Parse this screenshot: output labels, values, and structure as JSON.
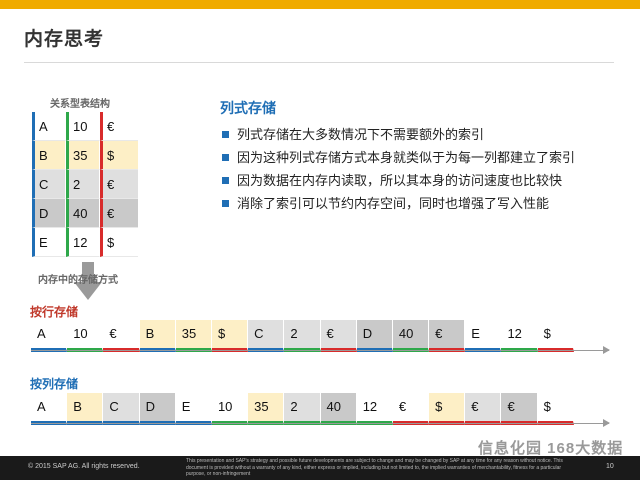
{
  "title": "内存思考",
  "relational": {
    "label": "关系型表结构",
    "rows": [
      {
        "a": "A",
        "b": "10",
        "c": "€",
        "bg": "w"
      },
      {
        "a": "B",
        "b": "35",
        "c": "$",
        "bg": "y"
      },
      {
        "a": "C",
        "b": "2",
        "c": "€",
        "bg": "g"
      },
      {
        "a": "D",
        "b": "40",
        "c": "€",
        "bg": "d"
      },
      {
        "a": "E",
        "b": "12",
        "c": "$",
        "bg": "w"
      }
    ]
  },
  "memory_label": "内存中的存储方式",
  "columnar": {
    "heading": "列式存储",
    "bullets": [
      "列式存储在大多数情况下不需要额外的索引",
      "因为这种列式存储方式本身就类似于为每一列都建立了索引",
      "因为数据在内存内读取，所以其本身的访问速度也比较快",
      "消除了索引可以节约内存空间，同时也增强了写入性能"
    ]
  },
  "row_store": {
    "label": "按行存储",
    "cells": [
      {
        "v": "A",
        "bg": "w",
        "u": "b"
      },
      {
        "v": "10",
        "bg": "w",
        "u": "g"
      },
      {
        "v": "€",
        "bg": "w",
        "u": "r"
      },
      {
        "v": "B",
        "bg": "y",
        "u": "b"
      },
      {
        "v": "35",
        "bg": "y",
        "u": "g"
      },
      {
        "v": "$",
        "bg": "y",
        "u": "r"
      },
      {
        "v": "C",
        "bg": "g",
        "u": "b"
      },
      {
        "v": "2",
        "bg": "g",
        "u": "g"
      },
      {
        "v": "€",
        "bg": "g",
        "u": "r"
      },
      {
        "v": "D",
        "bg": "d",
        "u": "b"
      },
      {
        "v": "40",
        "bg": "d",
        "u": "g"
      },
      {
        "v": "€",
        "bg": "d",
        "u": "r"
      },
      {
        "v": "E",
        "bg": "w",
        "u": "b"
      },
      {
        "v": "12",
        "bg": "w",
        "u": "g"
      },
      {
        "v": "$",
        "bg": "w",
        "u": "r"
      }
    ]
  },
  "col_store": {
    "label": "按列存储",
    "cells": [
      {
        "v": "A",
        "bg": "w",
        "u": "b"
      },
      {
        "v": "B",
        "bg": "y",
        "u": "b"
      },
      {
        "v": "C",
        "bg": "g",
        "u": "b"
      },
      {
        "v": "D",
        "bg": "d",
        "u": "b"
      },
      {
        "v": "E",
        "bg": "w",
        "u": "b"
      },
      {
        "v": "10",
        "bg": "w",
        "u": "g"
      },
      {
        "v": "35",
        "bg": "y",
        "u": "g"
      },
      {
        "v": "2",
        "bg": "g",
        "u": "g"
      },
      {
        "v": "40",
        "bg": "d",
        "u": "g"
      },
      {
        "v": "12",
        "bg": "w",
        "u": "g"
      },
      {
        "v": "€",
        "bg": "w",
        "u": "r"
      },
      {
        "v": "$",
        "bg": "y",
        "u": "r"
      },
      {
        "v": "€",
        "bg": "g",
        "u": "r"
      },
      {
        "v": "€",
        "bg": "d",
        "u": "r"
      },
      {
        "v": "$",
        "bg": "w",
        "u": "r"
      }
    ]
  },
  "colors": {
    "blue": "#1f6eb5",
    "green": "#2ea84a",
    "red": "#d82b2b",
    "accent": "#f0ab00"
  },
  "footer": {
    "copyright": "© 2015 SAP AG. All rights reserved.",
    "disclaimer": "This presentation and SAP's strategy and possible future developments are subject to change and may be changed by SAP at any time for any reason without notice. This document is provided without a warranty of any kind, either express or implied, including but not limited to, the implied warranties of merchantability, fitness for a particular purpose, or non-infringement",
    "page": "10"
  },
  "watermark": "信息化园 168大数据"
}
